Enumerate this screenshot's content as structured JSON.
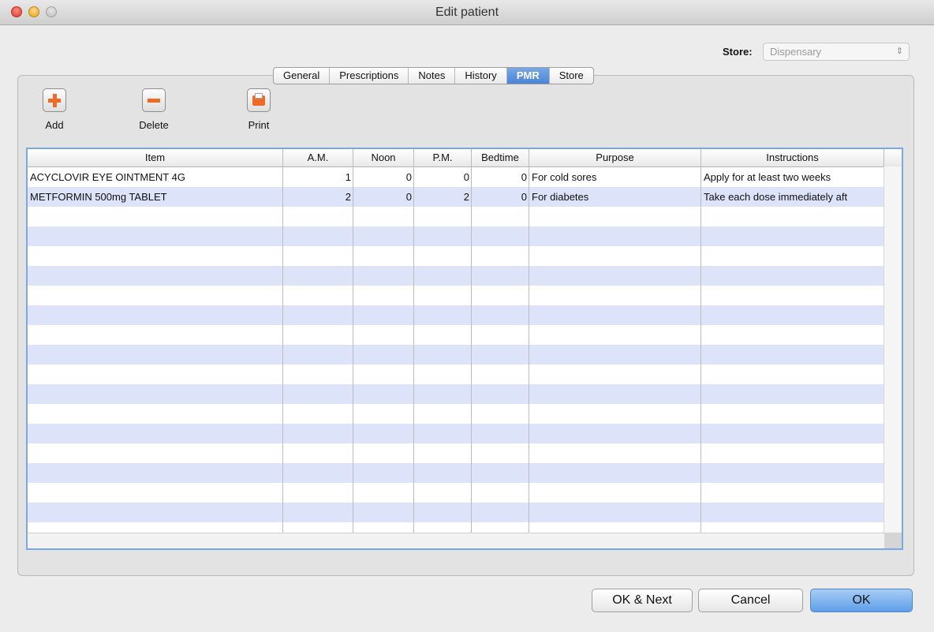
{
  "window": {
    "title": "Edit patient"
  },
  "store": {
    "label": "Store:",
    "value": "Dispensary"
  },
  "tabs": [
    {
      "label": "General",
      "active": false
    },
    {
      "label": "Prescriptions",
      "active": false
    },
    {
      "label": "Notes",
      "active": false
    },
    {
      "label": "History",
      "active": false
    },
    {
      "label": "PMR",
      "active": true
    },
    {
      "label": "Store",
      "active": false
    }
  ],
  "toolbar": {
    "add_label": "Add",
    "delete_label": "Delete",
    "print_label": "Print"
  },
  "table": {
    "columns": [
      "Item",
      "A.M.",
      "Noon",
      "P.M.",
      "Bedtime",
      "Purpose",
      "Instructions"
    ],
    "rows": [
      [
        "ACYCLOVIR EYE OINTMENT 4G",
        "1",
        "0",
        "0",
        "0",
        "For cold sores",
        "Apply for at least two weeks"
      ],
      [
        "METFORMIN 500mg TABLET",
        "2",
        "0",
        "2",
        "0",
        "For diabetes",
        "Take each dose immediately aft"
      ]
    ]
  },
  "buttons": {
    "ok_next": "OK & Next",
    "cancel": "Cancel",
    "ok": "OK"
  },
  "colors": {
    "accent": "#4b84d6",
    "row_stripe": "#dde3f8",
    "icon_orange": "#ee6a25"
  },
  "icons": {
    "add": "plus-icon",
    "delete": "minus-icon",
    "print": "printer-icon"
  }
}
